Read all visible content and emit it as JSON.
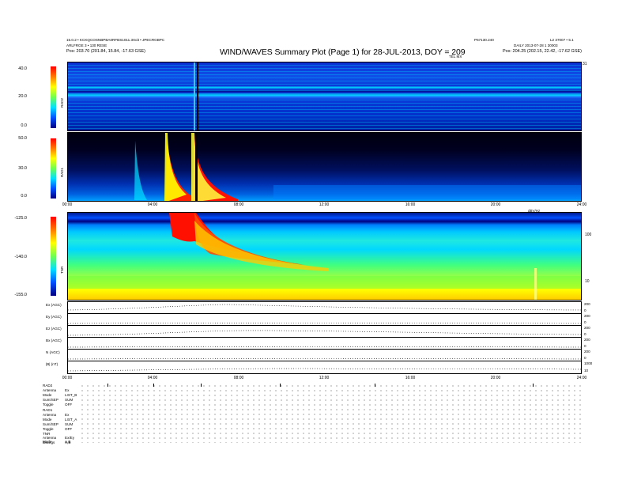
{
  "header": {
    "left_line1": "15.0.2 • KCKQCOSNBPBA0RFBS1011.3Xoit • JPECRGBPC",
    "left_line2": "ARLFRGE 3 • 130 RESE",
    "left_line3": "Pos: 203.70 (201.84, 15.84, -17.63 GSE)",
    "title": "WIND/WAVES Summary Plot (Page 1) for 28-JUL-2013, DOY = 209",
    "center_right_label": "P67130.240",
    "right_line1": "L2 37007 • 5.1",
    "right_line2": "DAILY 2013-07-28 1 30003",
    "right_line3": "Pos: 204.25 (202.15, 22.42, -17.62 GSE)",
    "rad2_timer": "TEL MX"
  },
  "panels": {
    "rad2": {
      "ylabel": "RAD2",
      "ticks": [
        "40.0",
        "20.0",
        "0.0"
      ],
      "right_tick": "31"
    },
    "rad1": {
      "ylabel": "RAD1",
      "ticks": [
        "50.0",
        "30.0",
        "0.0"
      ]
    },
    "tnr": {
      "ylabel": "TNR",
      "ticks": [
        "-125.0",
        "-140.0",
        "-155.0"
      ],
      "right_ticks": [
        "100",
        "10"
      ],
      "right_header": "dBV/Hz"
    },
    "traces": [
      {
        "label": "Ex (AGC)",
        "right_ticks": [
          "200",
          "0"
        ]
      },
      {
        "label": "Ey (AGC)",
        "right_ticks": [
          "200",
          "0"
        ]
      },
      {
        "label": "Ez (AGC)",
        "right_ticks": [
          "200",
          "0"
        ]
      },
      {
        "label": "Bx (AGC)",
        "right_ticks": [
          "200",
          "0"
        ]
      },
      {
        "label": "N (AGC)",
        "right_ticks": [
          "200",
          "0"
        ]
      },
      {
        "label": "|B| (nT)",
        "right_ticks": [
          "1000",
          "10"
        ]
      }
    ]
  },
  "time_axis": [
    "00:00",
    "04:00",
    "08:00",
    "12:00",
    "16:00",
    "20:00",
    "24:00"
  ],
  "modes": {
    "rad2_block": [
      {
        "label": "RAD2"
      },
      {
        "label": "Antenna",
        "value": "Ex"
      },
      {
        "label": "Mode",
        "value": "LIST_B"
      },
      {
        "label": "Sum/SEP",
        "value": "SUM"
      },
      {
        "label": "Toggle",
        "value": "OFF"
      }
    ],
    "rad1_block": [
      {
        "label": "RAD1"
      },
      {
        "label": "Antenna",
        "value": "Ex"
      },
      {
        "label": "Mode",
        "value": "LIST_A"
      },
      {
        "label": "Sum/SEP",
        "value": "SUM"
      },
      {
        "label": "Toggle",
        "value": "OFF"
      }
    ],
    "tnr_block": [
      {
        "label": "TNR"
      },
      {
        "label": "Antenna",
        "value": "Ex/Ey"
      },
      {
        "label": "Mode",
        "value": "A,B"
      },
      {
        "label": "Bwargs",
        "value": "A,B"
      }
    ]
  },
  "chart_data": {
    "type": "heatmap",
    "title": "WIND/WAVES Summary Plot (Page 1) for 28-JUL-2013, DOY = 209",
    "x_hours": [
      0,
      4,
      8,
      12,
      16,
      20,
      24
    ],
    "panels": [
      {
        "name": "RAD2",
        "y_range": [
          0,
          40
        ],
        "colorbar": "rainbow"
      },
      {
        "name": "RAD1",
        "y_range": [
          0,
          50
        ],
        "colorbar": "rainbow"
      },
      {
        "name": "TNR",
        "y_range": [
          -155,
          -125
        ],
        "colorbar": "rainbow"
      }
    ],
    "radio_bursts_hours": [
      3.3,
      4.7,
      5.8
    ],
    "colors": {
      "low": "#00007f",
      "mid": "#00e0ff",
      "high": "#ff0000",
      "yellow": "#ffff00"
    }
  }
}
